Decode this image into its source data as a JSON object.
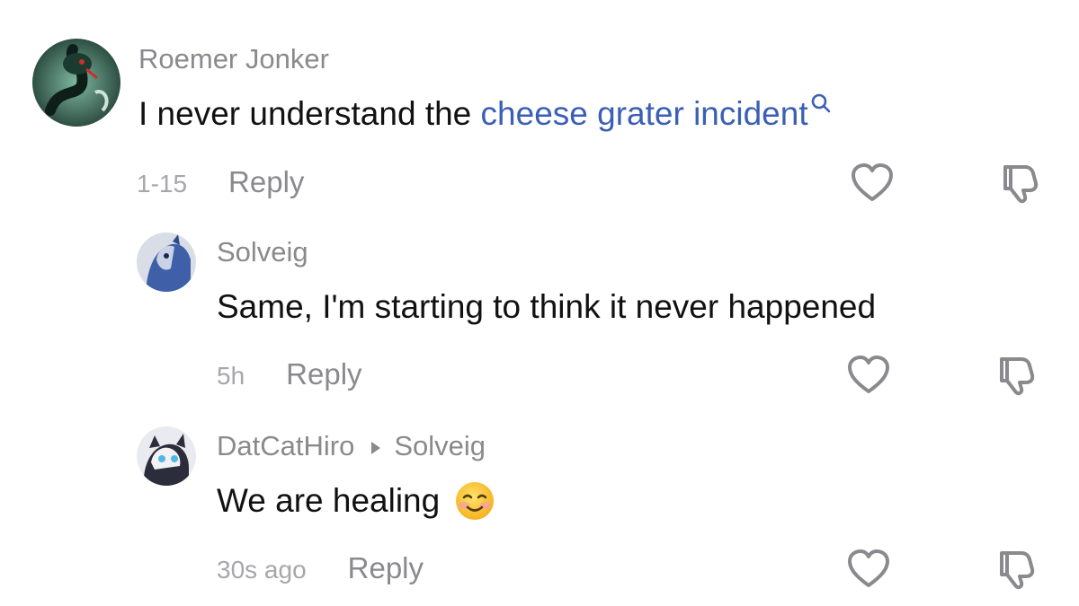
{
  "comments": [
    {
      "author": "Roemer Jonker",
      "reply_to": "",
      "text": "I never understand the ",
      "link_text": "cheese grater incident",
      "emoji": "",
      "time": "1-15",
      "reply_label": "Reply",
      "avatar_icon": "snake-avatar"
    },
    {
      "author": "Solveig",
      "reply_to": "",
      "text": "Same, I'm starting to think it never happened",
      "link_text": "",
      "emoji": "",
      "time": "5h",
      "reply_label": "Reply",
      "avatar_icon": "blue-character-avatar"
    },
    {
      "author": "DatCatHiro",
      "reply_to": "Solveig",
      "text": "We are healing",
      "link_text": "",
      "emoji": "smiling-face-with-smiling-eyes",
      "time": "30s ago",
      "reply_label": "Reply",
      "avatar_icon": "cat-character-avatar"
    }
  ],
  "colors": {
    "link": "#3b5fb5",
    "author": "#8a8a8e",
    "meta": "#a7a7ab",
    "icon": "#8a8a8e"
  },
  "icons": {
    "like": "heart-outline-icon",
    "dislike": "thumbs-down-outline-icon",
    "search": "search-icon",
    "reply_arrow": "triangle-right-icon"
  }
}
